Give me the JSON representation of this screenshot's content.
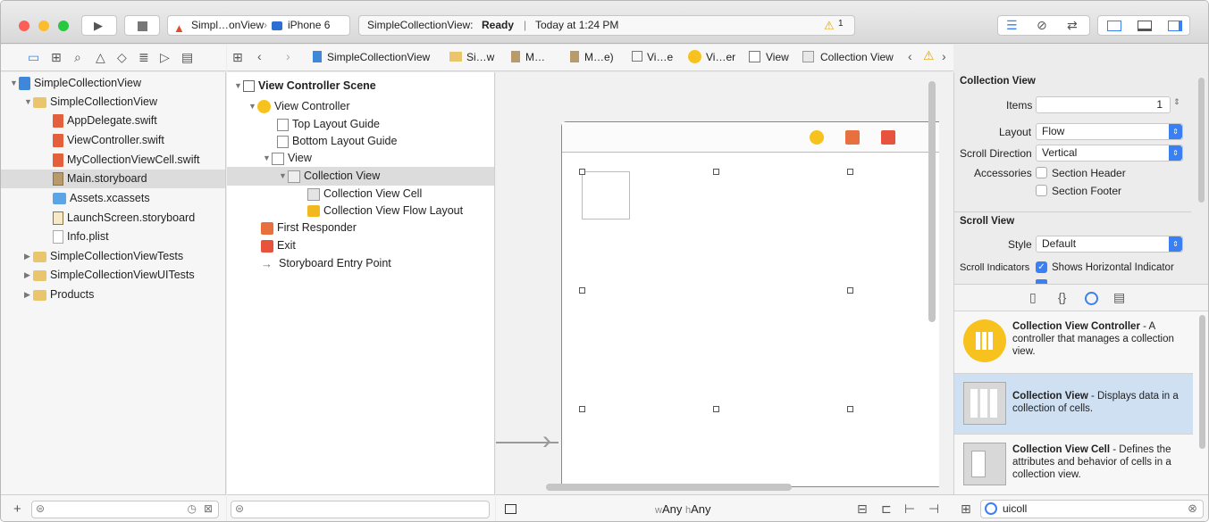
{
  "toolbar": {
    "scheme": "Simpl…onView",
    "device": "iPhone 6",
    "status_project": "SimpleCollectionView:",
    "status_state": "Ready",
    "status_time": "Today at 1:24 PM",
    "warning_count": "1"
  },
  "jumpbar": {
    "items": [
      "SimpleCollectionView",
      "Si…w",
      "M…",
      "M…e)",
      "Vi…e",
      "Vi…er",
      "View",
      "Collection View"
    ]
  },
  "navigator": {
    "items": [
      {
        "label": "SimpleCollectionView",
        "icon": "project-icon"
      },
      {
        "label": "SimpleCollectionView",
        "icon": "folder-icon"
      },
      {
        "label": "AppDelegate.swift",
        "icon": "swift-file-icon"
      },
      {
        "label": "ViewController.swift",
        "icon": "swift-file-icon"
      },
      {
        "label": "MyCollectionViewCell.swift",
        "icon": "swift-file-icon"
      },
      {
        "label": "Main.storyboard",
        "icon": "storyboard-icon"
      },
      {
        "label": "Assets.xcassets",
        "icon": "assets-icon"
      },
      {
        "label": "LaunchScreen.storyboard",
        "icon": "storyboard-icon"
      },
      {
        "label": "Info.plist",
        "icon": "plist-icon"
      },
      {
        "label": "SimpleCollectionViewTests",
        "icon": "folder-icon"
      },
      {
        "label": "SimpleCollectionViewUITests",
        "icon": "folder-icon"
      },
      {
        "label": "Products",
        "icon": "folder-icon"
      }
    ]
  },
  "outline": {
    "items": [
      {
        "label": "View Controller Scene"
      },
      {
        "label": "View Controller"
      },
      {
        "label": "Top Layout Guide"
      },
      {
        "label": "Bottom Layout Guide"
      },
      {
        "label": "View"
      },
      {
        "label": "Collection View"
      },
      {
        "label": "Collection View Cell"
      },
      {
        "label": "Collection View Flow Layout"
      },
      {
        "label": "First Responder"
      },
      {
        "label": "Exit"
      },
      {
        "label": "Storyboard Entry Point"
      }
    ]
  },
  "canvas": {
    "size_class_w": "w",
    "size_class_w_value": "Any",
    "size_class_h": "h",
    "size_class_h_value": "Any"
  },
  "inspector": {
    "section_collection_view": "Collection View",
    "items_label": "Items",
    "items_value": "1",
    "layout_label": "Layout",
    "layout_value": "Flow",
    "scroll_direction_label": "Scroll Direction",
    "scroll_direction_value": "Vertical",
    "accessories_label": "Accessories",
    "section_header": "Section Header",
    "section_footer": "Section Footer",
    "section_scroll_view": "Scroll View",
    "style_label": "Style",
    "style_value": "Default",
    "scroll_indicators_label": "Scroll Indicators",
    "shows_horizontal": "Shows Horizontal Indicator"
  },
  "library": {
    "items": [
      {
        "title": "Collection View Controller",
        "desc": " - A controller that manages a collection view."
      },
      {
        "title": "Collection View",
        "desc": " - Displays data in a collection of cells."
      },
      {
        "title": "Collection View Cell",
        "desc": " - Defines the attributes and behavior of cells in a collection view."
      }
    ],
    "filter_value": "uicoll"
  },
  "colors": {
    "accent": "#3a80f2",
    "selection": "#cfe0f3"
  }
}
